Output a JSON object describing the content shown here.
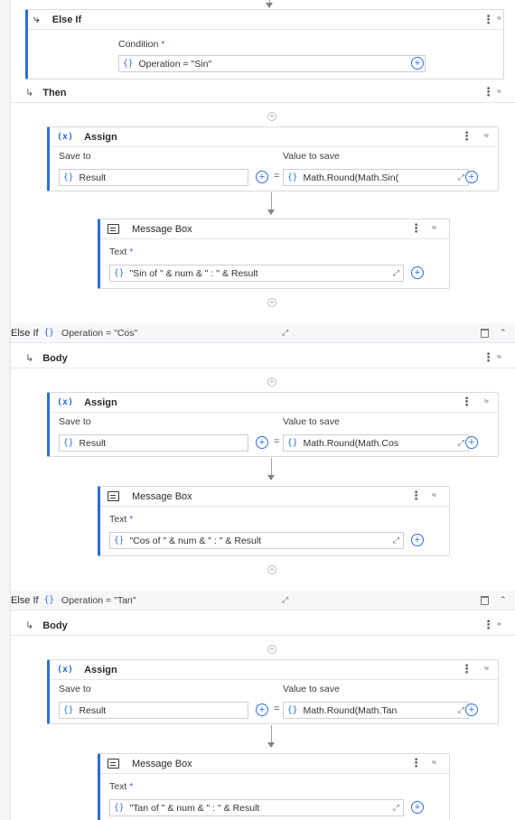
{
  "elseif_top": {
    "title": "Else If",
    "condition_label": "Condition",
    "required_mark": "*",
    "condition_value": "Operation = \"Sin\""
  },
  "then_label": "Then",
  "body_label": "Body",
  "save_to_label": "Save to",
  "value_to_save_label": "Value to save",
  "assign_title": "Assign",
  "message_box_title": "Message Box",
  "text_label": "Text",
  "required_mark": "*",
  "else_if_label": "Else If",
  "block1": {
    "save_to": "Result",
    "value": "Math.Round(Math.Sin(",
    "text": "\"Sin of \" & num & \" : \" & Result"
  },
  "elseif_cos": {
    "condition": "Operation = \"Cos\""
  },
  "block2": {
    "save_to": "Result",
    "value": "Math.Round(Math.Cos",
    "text": "\"Cos of \" & num & \" : \" & Result"
  },
  "elseif_tan": {
    "condition": "Operation = \"Tan\""
  },
  "block3": {
    "save_to": "Result",
    "value": "Math.Round(Math.Tan",
    "text": "\"Tan of \" & num & \" : \" & Result"
  },
  "icons": {
    "braces": "{}",
    "expand": "↗",
    "plus": "+",
    "kebab": "⋮",
    "chevron_up": "⌃",
    "double_chevron": "≈",
    "assign": "(x)",
    "branch": "↳"
  }
}
